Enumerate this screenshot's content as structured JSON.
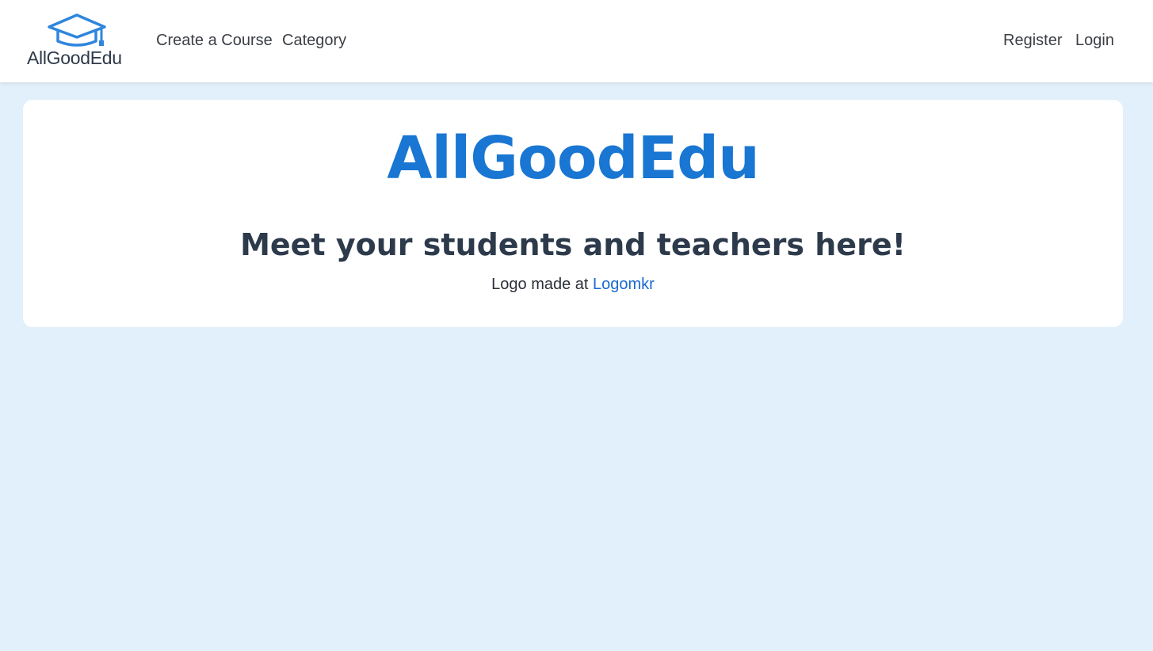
{
  "navbar": {
    "brand": {
      "logo_text": "AllGoodEdu",
      "icon": "graduation-cap-icon",
      "icon_color": "#2f86dd"
    },
    "left_links": [
      "Create a Course",
      "Category"
    ],
    "right_links": [
      "Register",
      "Login"
    ]
  },
  "hero": {
    "title": "AllGoodEdu",
    "subtitle": "Meet your students and teachers here!",
    "credit_prefix": "Logo made at",
    "credit_link": "Logomkr"
  },
  "colors": {
    "page_background": "#e2f0fb",
    "title_blue": "#1976d2",
    "subtitle_dark": "#2c3a4b",
    "link_blue": "#1a6ad0"
  }
}
